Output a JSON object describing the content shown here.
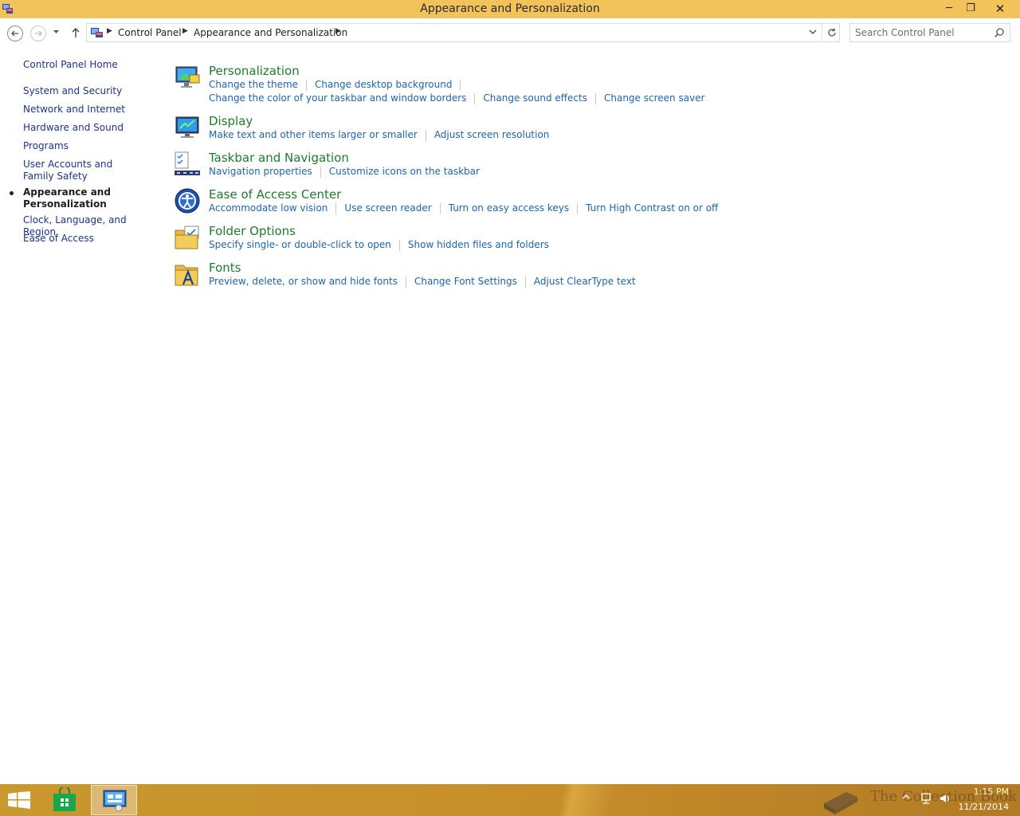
{
  "window": {
    "title": "Appearance and Personalization",
    "minimize_glyph": "─",
    "maximize_glyph": "❐",
    "close_glyph": "✕"
  },
  "address_bar": {
    "breadcrumbs": [
      "Control Panel",
      "Appearance and Personalization"
    ],
    "icon": "control-panel-icon"
  },
  "search": {
    "placeholder": "Search Control Panel"
  },
  "sidebar": {
    "home": "Control Panel Home",
    "items": [
      {
        "label": "System and Security"
      },
      {
        "label": "Network and Internet"
      },
      {
        "label": "Hardware and Sound"
      },
      {
        "label": "Programs"
      },
      {
        "label": "User Accounts and Family Safety"
      },
      {
        "label": "Appearance and Personalization",
        "current": true
      },
      {
        "label": "Clock, Language, and Region"
      },
      {
        "label": "Ease of Access"
      }
    ]
  },
  "categories": [
    {
      "title": "Personalization",
      "icon": "personalization-icon",
      "rows": [
        [
          "Change the theme",
          "Change desktop background"
        ],
        [
          "Change the color of your taskbar and window borders",
          "Change sound effects",
          "Change screen saver"
        ]
      ]
    },
    {
      "title": "Display",
      "icon": "display-icon",
      "rows": [
        [
          "Make text and other items larger or smaller",
          "Adjust screen resolution"
        ]
      ]
    },
    {
      "title": "Taskbar and Navigation",
      "icon": "taskbar-icon",
      "rows": [
        [
          "Navigation properties",
          "Customize icons on the taskbar"
        ]
      ]
    },
    {
      "title": "Ease of Access Center",
      "icon": "ease-of-access-icon",
      "rows": [
        [
          "Accommodate low vision",
          "Use screen reader",
          "Turn on easy access keys",
          "Turn High Contrast on or off"
        ]
      ]
    },
    {
      "title": "Folder Options",
      "icon": "folder-options-icon",
      "rows": [
        [
          "Specify single- or double-click to open",
          "Show hidden files and folders"
        ]
      ]
    },
    {
      "title": "Fonts",
      "icon": "fonts-icon",
      "rows": [
        [
          "Preview, delete, or show and hide fonts",
          "Change Font Settings",
          "Adjust ClearType text"
        ]
      ]
    }
  ],
  "taskbar": {
    "time": "1:15 PM",
    "date": "11/21/2014",
    "watermark": "The Collection Book",
    "color": "#c68e2a"
  },
  "colors": {
    "title_bar": "#f1c35a",
    "category_title": "#1e7b2e",
    "task_link": "#1e64aa",
    "nav_link": "#1e3287"
  }
}
